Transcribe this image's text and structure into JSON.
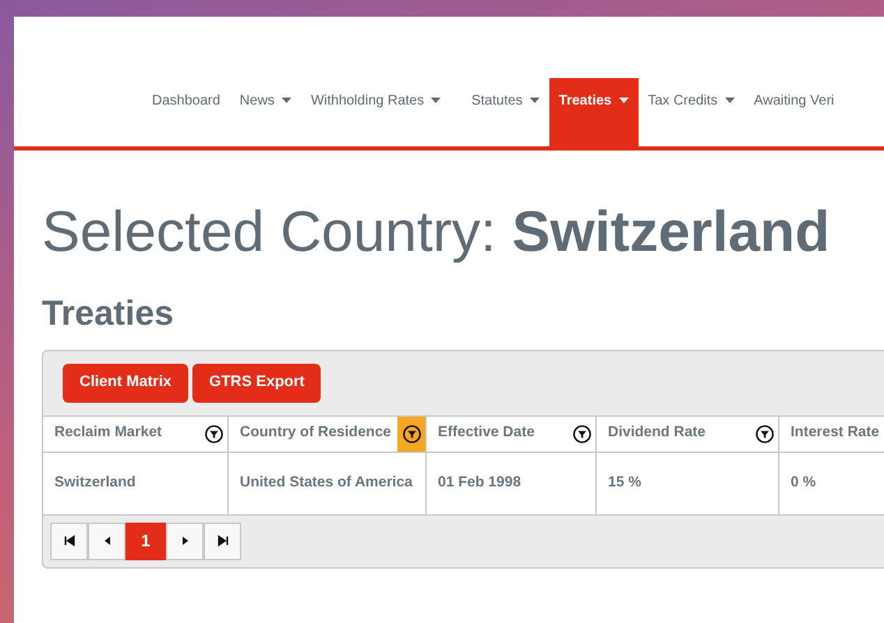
{
  "nav": [
    {
      "label": "Dashboard",
      "dropdown": false,
      "selected": false
    },
    {
      "label": "News",
      "dropdown": true,
      "selected": false
    },
    {
      "label": "Withholding Rates",
      "dropdown": true,
      "selected": false
    },
    {
      "label": "Statutes",
      "dropdown": true,
      "selected": false
    },
    {
      "label": "Treaties",
      "dropdown": true,
      "selected": true
    },
    {
      "label": "Tax Credits",
      "dropdown": true,
      "selected": false
    },
    {
      "label": "Awaiting Veri",
      "dropdown": false,
      "selected": false
    }
  ],
  "heading": {
    "prefix": "Selected Country: ",
    "country": "Switzerland"
  },
  "section_title": "Treaties",
  "toolbar": [
    "Client Matrix",
    "GTRS Export"
  ],
  "table": {
    "columns": [
      {
        "label": "Reclaim Market",
        "filtered": false
      },
      {
        "label": "Country of Residence",
        "filtered": true
      },
      {
        "label": "Effective Date",
        "filtered": false
      },
      {
        "label": "Dividend Rate",
        "filtered": false
      },
      {
        "label": "Interest Rate"
      }
    ],
    "rows": [
      [
        "Switzerland",
        "United States of America",
        "01 Feb 1998",
        "15 %",
        "0 %"
      ]
    ]
  },
  "pager": {
    "pages": [
      {
        "label": "1",
        "selected": true
      }
    ]
  }
}
